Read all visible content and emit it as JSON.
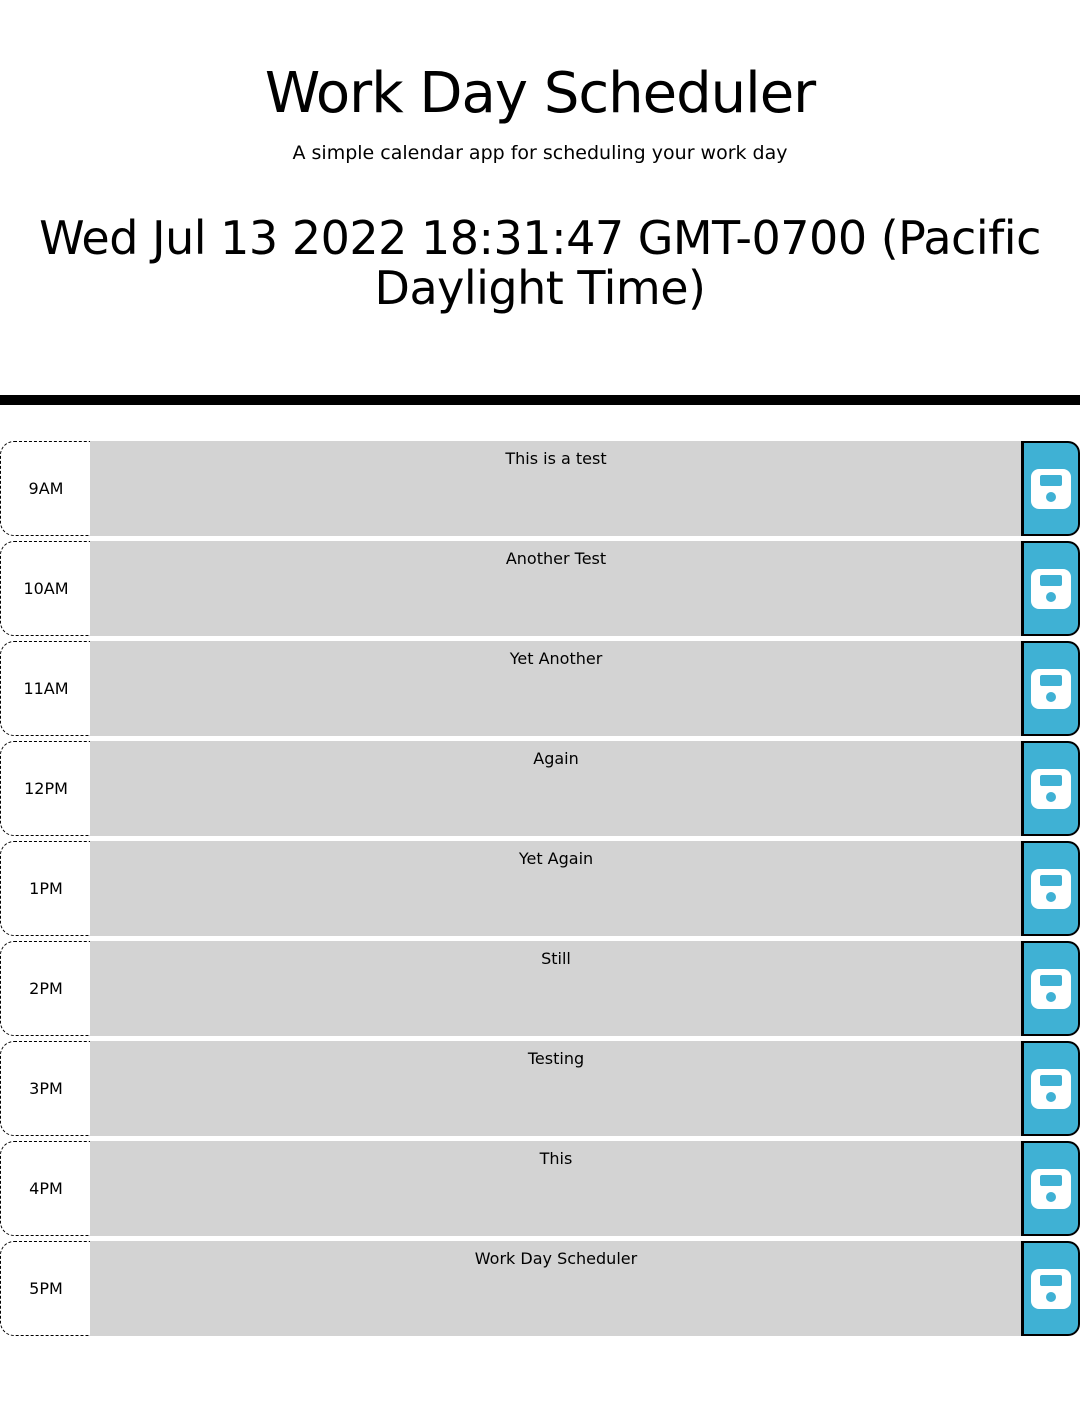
{
  "header": {
    "title": "Work Day Scheduler",
    "subtitle": "A simple calendar app for scheduling your work day",
    "current_day": "Wed Jul 13 2022 18:31:47 GMT-0700 (Pacific Daylight Time)"
  },
  "colors": {
    "past_row": "#d3d3d3",
    "save_button": "#3fb1d4"
  },
  "save_icon": "floppy-disk-icon",
  "time_blocks": [
    {
      "hour": "9AM",
      "description": "This is a test"
    },
    {
      "hour": "10AM",
      "description": "Another Test"
    },
    {
      "hour": "11AM",
      "description": "Yet Another"
    },
    {
      "hour": "12PM",
      "description": "Again"
    },
    {
      "hour": "1PM",
      "description": "Yet Again"
    },
    {
      "hour": "2PM",
      "description": "Still"
    },
    {
      "hour": "3PM",
      "description": "Testing"
    },
    {
      "hour": "4PM",
      "description": "This"
    },
    {
      "hour": "5PM",
      "description": "Work Day Scheduler"
    }
  ]
}
